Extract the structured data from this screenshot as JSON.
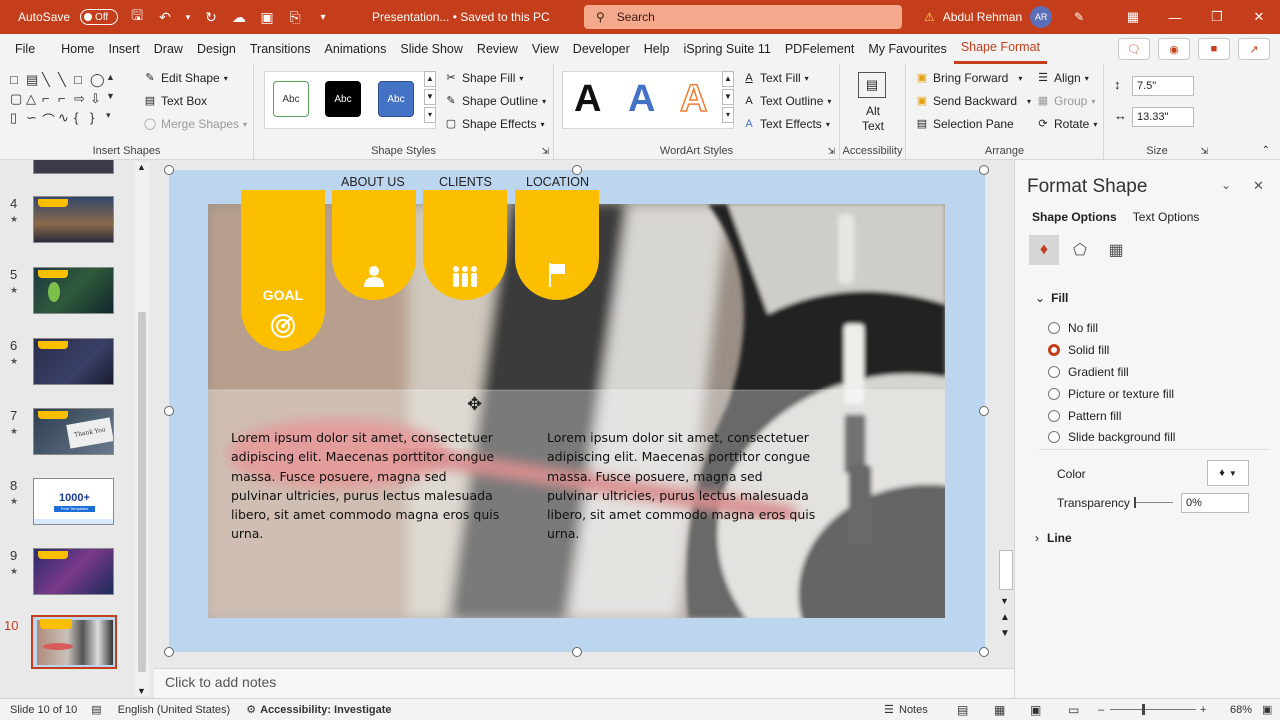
{
  "titlebar": {
    "autosave_label": "AutoSave",
    "autosave_state": "Off",
    "doc_title": "Presentation... • Saved to this PC",
    "search_placeholder": "Search",
    "user_name": "Abdul Rehman",
    "user_initials": "AR"
  },
  "menu": {
    "items": [
      "File",
      "Home",
      "Insert",
      "Draw",
      "Design",
      "Transitions",
      "Animations",
      "Slide Show",
      "Review",
      "View",
      "Developer",
      "Help",
      "iSpring Suite 11",
      "PDFelement",
      "My Favourites",
      "Shape Format"
    ],
    "active": "Shape Format"
  },
  "ribbon": {
    "insert_shapes": {
      "label": "Insert Shapes",
      "edit_shape": "Edit Shape",
      "text_box": "Text Box",
      "merge_shapes": "Merge Shapes"
    },
    "shape_styles": {
      "label": "Shape Styles",
      "samples": [
        "Abc",
        "Abc",
        "Abc"
      ],
      "shape_fill": "Shape Fill",
      "shape_outline": "Shape Outline",
      "shape_effects": "Shape Effects"
    },
    "wordart": {
      "label": "WordArt Styles",
      "samples": [
        "A",
        "A",
        "A"
      ],
      "text_fill": "Text Fill",
      "text_outline": "Text Outline",
      "text_effects": "Text Effects"
    },
    "accessibility": {
      "label": "Accessibility",
      "alt_text_1": "Alt",
      "alt_text_2": "Text"
    },
    "arrange": {
      "label": "Arrange",
      "bring_forward": "Bring Forward",
      "send_backward": "Send Backward",
      "selection_pane": "Selection Pane",
      "align": "Align",
      "group": "Group",
      "rotate": "Rotate"
    },
    "size": {
      "label": "Size",
      "height": "7.5\"",
      "width": "13.33\""
    }
  },
  "slides_panel": {
    "slides": [
      {
        "num": "4",
        "star": "★"
      },
      {
        "num": "5",
        "star": "★"
      },
      {
        "num": "6",
        "star": "★"
      },
      {
        "num": "7",
        "star": "★"
      },
      {
        "num": "8",
        "star": "★"
      },
      {
        "num": "9",
        "star": "★"
      },
      {
        "num": "10",
        "star": ""
      }
    ],
    "thumb8_text": "1000+",
    "thumb8_sub": "Free Templates",
    "thumb7_text": "Thank You"
  },
  "slide": {
    "nav": [
      "ABOUT US",
      "CLIENTS",
      "LOCATION"
    ],
    "goal_label": "GOAL",
    "lorem_left": "Lorem ipsum dolor sit amet, consectetuer adipiscing elit. Maecenas porttitor congue massa. Fusce posuere, magna sed pulvinar ultricies, purus lectus malesuada libero, sit amet commodo magna eros quis urna.",
    "lorem_right": "Lorem ipsum dolor sit amet, consectetuer adipiscing elit. Maecenas porttitor congue massa. Fusce posuere, magna sed pulvinar ultricies, purus lectus malesuada libero, sit amet commodo magna eros quis urna."
  },
  "notes_placeholder": "Click to add notes",
  "format_pane": {
    "title": "Format Shape",
    "tabs": [
      "Shape Options",
      "Text Options"
    ],
    "fill_section": "Fill",
    "options": [
      {
        "label": "No fill",
        "selected": false
      },
      {
        "label": "Solid fill",
        "selected": true
      },
      {
        "label": "Gradient fill",
        "selected": false
      },
      {
        "label": "Picture or texture fill",
        "selected": false
      },
      {
        "label": "Pattern fill",
        "selected": false
      },
      {
        "label": "Slide background fill",
        "selected": false
      }
    ],
    "color_label": "Color",
    "transparency_label": "Transparency",
    "transparency_value": "0%",
    "line_section": "Line"
  },
  "status": {
    "slide_info": "Slide 10 of 10",
    "language": "English (United States)",
    "accessibility": "Accessibility: Investigate",
    "notes_label": "Notes",
    "zoom": "68%"
  },
  "colors": {
    "accent": "#c43e1c",
    "banner": "#fbbf00",
    "slide_bg": "#bcd6ef"
  }
}
